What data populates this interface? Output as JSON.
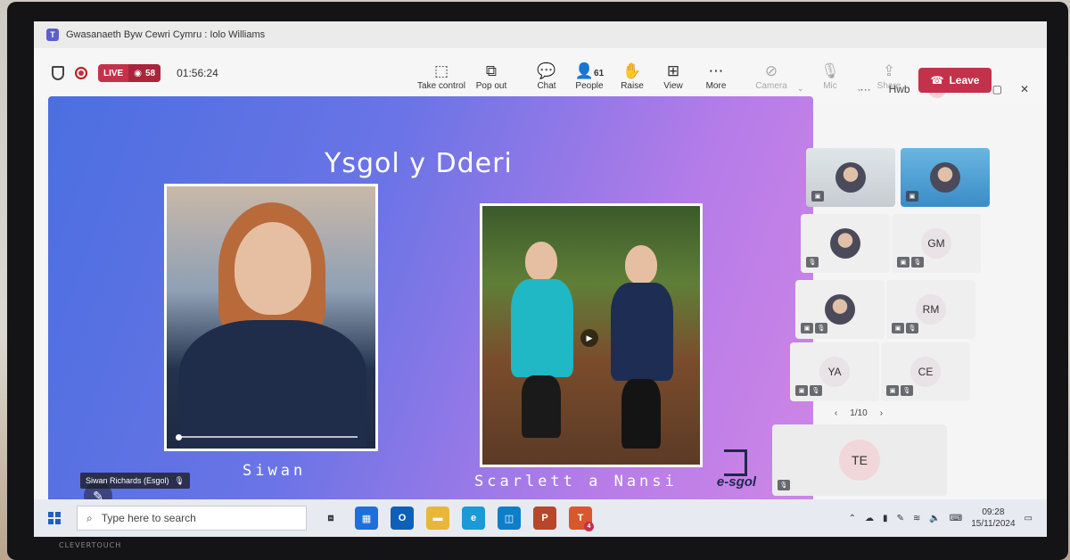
{
  "window": {
    "title": "Gwasanaeth Byw Cewri Cymru : Iolo Williams",
    "hwb_label": "Hwb",
    "user_initials": "TE"
  },
  "meeting": {
    "live_label": "LIVE",
    "viewer_count": "58",
    "elapsed": "01:56:24",
    "people_count": "61"
  },
  "toolbar": {
    "take_control": "Take control",
    "pop_out": "Pop out",
    "chat": "Chat",
    "people": "People",
    "raise": "Raise",
    "view": "View",
    "more": "More",
    "camera": "Camera",
    "mic": "Mic",
    "share": "Share",
    "leave": "Leave"
  },
  "slide": {
    "title": "Ysgol y Dderi",
    "caption_left": "Siwan",
    "caption_right": "Scarlett a Nansi",
    "brand": "e-sgol"
  },
  "speaker_tag": "Siwan Richards (Esgol)",
  "participants": [
    {
      "initials": "",
      "kind": "video"
    },
    {
      "initials": "",
      "kind": "video"
    },
    {
      "initials": "",
      "kind": "photo"
    },
    {
      "initials": "GM",
      "kind": "initials"
    },
    {
      "initials": "",
      "kind": "photo"
    },
    {
      "initials": "RM",
      "kind": "initials"
    },
    {
      "initials": "YA",
      "kind": "initials"
    },
    {
      "initials": "CE",
      "kind": "initials"
    }
  ],
  "pager": "1/10",
  "self_initials": "TE",
  "taskbar": {
    "search_placeholder": "Type here to search",
    "time": "09:28",
    "date": "15/11/2024",
    "teams_badge": "4"
  },
  "monitor_brand": "CLEVERTOUCH",
  "colors": {
    "leave": "#c4314b",
    "live": "#c4314b",
    "teams": "#5b5fc7"
  }
}
